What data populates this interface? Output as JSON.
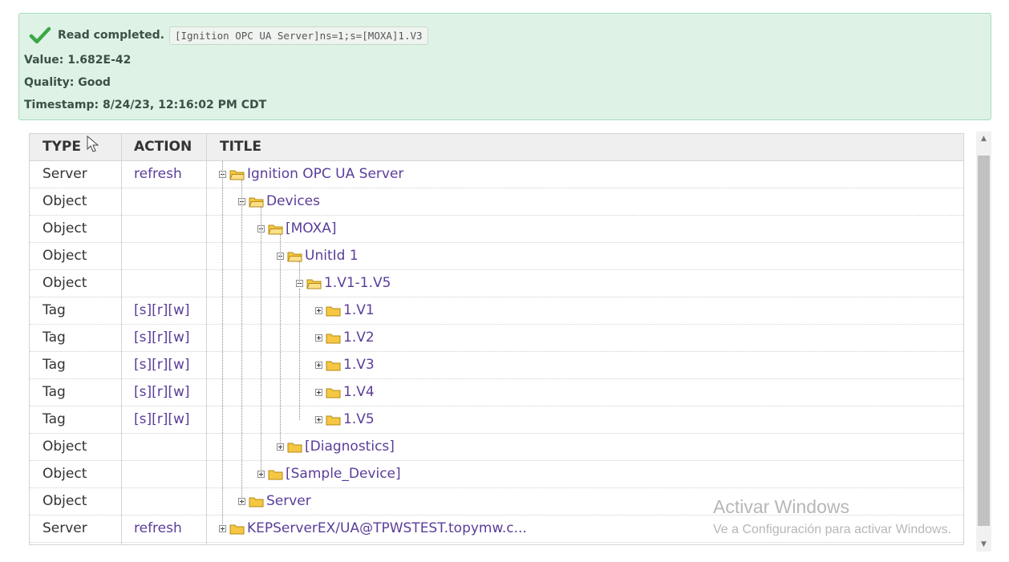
{
  "alert": {
    "status": "Read completed.",
    "node_id": "[Ignition OPC UA Server]ns=1;s=[MOXA]1.V3",
    "value_line": "Value: 1.682E-42",
    "quality_line": "Quality: Good",
    "timestamp_line": "Timestamp: 8/24/23, 12:16:02 PM CDT",
    "icon": "check-icon",
    "color": "#3aa845"
  },
  "table": {
    "headers": {
      "type": "TYPE",
      "action": "ACTION",
      "title": "TITLE"
    },
    "rows": [
      {
        "type": "Server",
        "action": "refresh",
        "title": "Ignition OPC UA Server",
        "expanded": true
      },
      {
        "type": "Object",
        "action": "",
        "title": "Devices",
        "expanded": true
      },
      {
        "type": "Object",
        "action": "",
        "title": "[MOXA]",
        "expanded": true
      },
      {
        "type": "Object",
        "action": "",
        "title": "UnitId 1",
        "expanded": true
      },
      {
        "type": "Object",
        "action": "",
        "title": "1.V1-1.V5",
        "expanded": true
      },
      {
        "type": "Tag",
        "action": "[s][r][w]",
        "title": "1.V1",
        "expanded": false
      },
      {
        "type": "Tag",
        "action": "[s][r][w]",
        "title": "1.V2",
        "expanded": false
      },
      {
        "type": "Tag",
        "action": "[s][r][w]",
        "title": "1.V3",
        "expanded": false
      },
      {
        "type": "Tag",
        "action": "[s][r][w]",
        "title": "1.V4",
        "expanded": false
      },
      {
        "type": "Tag",
        "action": "[s][r][w]",
        "title": "1.V5",
        "expanded": false
      },
      {
        "type": "Object",
        "action": "",
        "title": "[Diagnostics]",
        "expanded": false
      },
      {
        "type": "Object",
        "action": "",
        "title": "[Sample_Device]",
        "expanded": false
      },
      {
        "type": "Object",
        "action": "",
        "title": "Server",
        "expanded": false
      },
      {
        "type": "Server",
        "action": "refresh",
        "title": "KEPServerEX/UA@TPWSTEST.topymw.c...",
        "expanded": false
      }
    ]
  },
  "watermark": {
    "title": "Activar Windows",
    "subtitle": "Ve a Configuración para activar Windows."
  },
  "colors": {
    "link": "#5a3d9a",
    "folder": "#f5c743",
    "header_bg": "#efefef"
  }
}
